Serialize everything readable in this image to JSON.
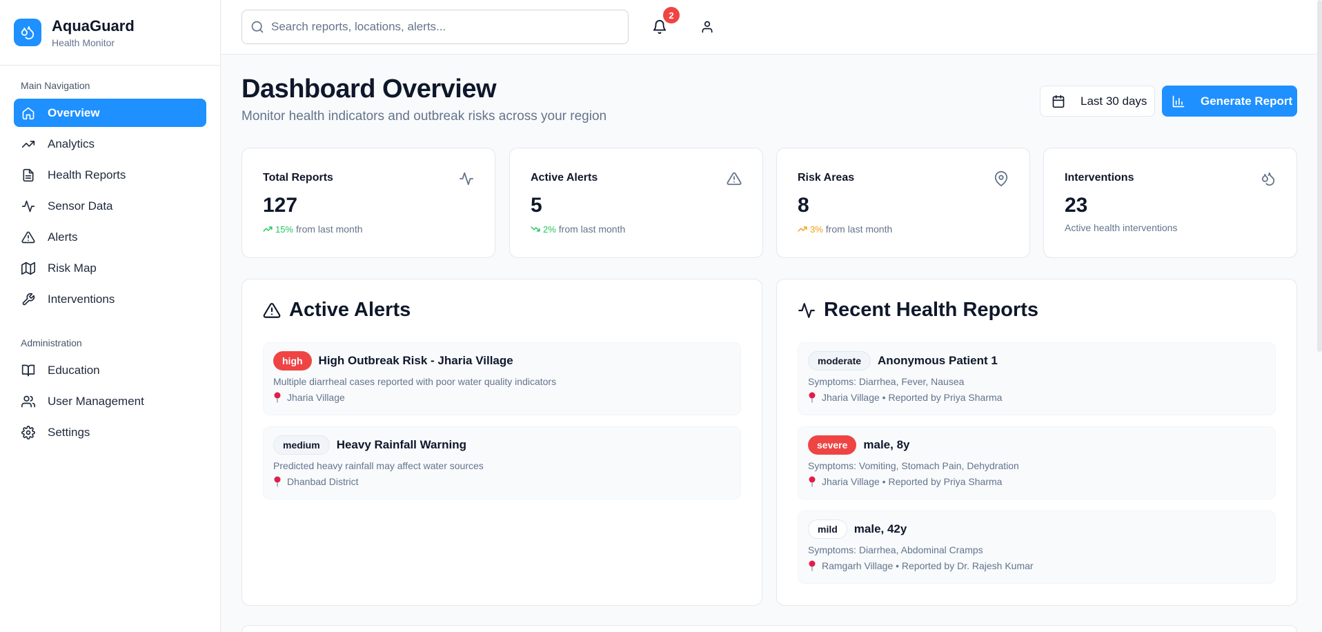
{
  "brand": {
    "name": "AquaGuard",
    "subtitle": "Health Monitor"
  },
  "sidebar": {
    "main_heading": "Main Navigation",
    "main_items": [
      {
        "label": "Overview",
        "icon": "home-icon",
        "active": true
      },
      {
        "label": "Analytics",
        "icon": "trending-up-icon"
      },
      {
        "label": "Health Reports",
        "icon": "file-text-icon"
      },
      {
        "label": "Sensor Data",
        "icon": "activity-icon"
      },
      {
        "label": "Alerts",
        "icon": "alert-triangle-icon"
      },
      {
        "label": "Risk Map",
        "icon": "map-icon"
      },
      {
        "label": "Interventions",
        "icon": "wrench-icon"
      }
    ],
    "admin_heading": "Administration",
    "admin_items": [
      {
        "label": "Education",
        "icon": "book-open-icon"
      },
      {
        "label": "User Management",
        "icon": "users-icon"
      },
      {
        "label": "Settings",
        "icon": "gear-icon"
      }
    ]
  },
  "topbar": {
    "search_placeholder": "Search reports, locations, alerts...",
    "notification_count": "2"
  },
  "header": {
    "title": "Dashboard Overview",
    "subtitle": "Monitor health indicators and outbreak risks across your region",
    "date_range": "Last 30 days",
    "generate_label": "Generate Report"
  },
  "stats": [
    {
      "label": "Total Reports",
      "value": "127",
      "pct": "15%",
      "note": "from last month",
      "icon": "activity-icon"
    },
    {
      "label": "Active Alerts",
      "value": "5",
      "pct": "2%",
      "note": "from last month",
      "icon": "alert-triangle-icon"
    },
    {
      "label": "Risk Areas",
      "value": "8",
      "pct": "3%",
      "note": "from last month",
      "icon": "map-pin-icon"
    },
    {
      "label": "Interventions",
      "value": "23",
      "note": "Active health interventions",
      "icon": "droplets-icon"
    }
  ],
  "alerts_panel": {
    "title": "Active Alerts",
    "items": [
      {
        "level": "high",
        "title": "High Outbreak Risk - Jharia Village",
        "desc": "Multiple diarrheal cases reported with poor water quality indicators",
        "location": "Jharia Village"
      },
      {
        "level": "medium",
        "title": "Heavy Rainfall Warning",
        "desc": "Predicted heavy rainfall may affect water sources",
        "location": "Dhanbad District"
      }
    ]
  },
  "reports_panel": {
    "title": "Recent Health Reports",
    "items": [
      {
        "severity": "moderate",
        "title": "Anonymous Patient 1",
        "symptoms": "Symptoms: Diarrhea, Fever, Nausea",
        "meta": "Jharia Village • Reported by Priya Sharma"
      },
      {
        "severity": "severe",
        "title": "male, 8y",
        "symptoms": "Symptoms: Vomiting, Stomach Pain, Dehydration",
        "meta": "Jharia Village • Reported by Priya Sharma"
      },
      {
        "severity": "mild",
        "title": "male, 42y",
        "symptoms": "Symptoms: Diarrhea, Abdominal Cramps",
        "meta": "Ramgarh Village • Reported by Dr. Rajesh Kumar"
      }
    ]
  },
  "colors": {
    "primary": "#1e90ff",
    "danger": "#ef4444",
    "success": "#22c55e",
    "warning": "#f59e0b"
  }
}
